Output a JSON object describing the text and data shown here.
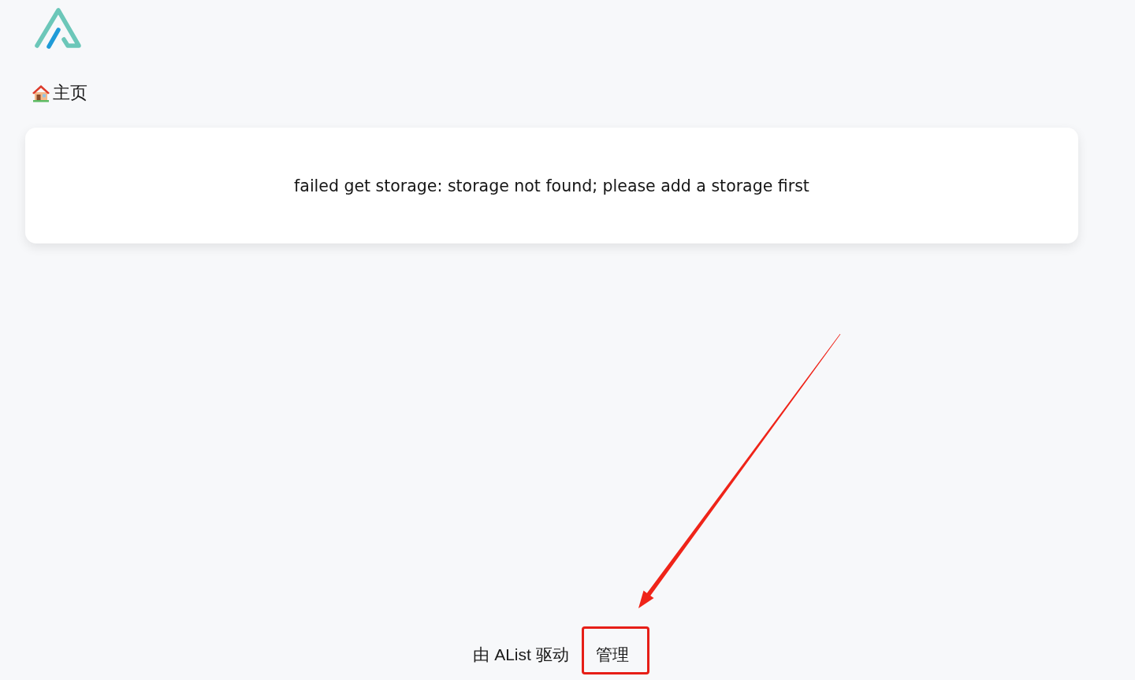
{
  "breadcrumb": [
    {
      "label": "主页",
      "kind": "home"
    }
  ],
  "message": "failed get storage: storage not found; please add a storage first",
  "footer": {
    "links": [
      {
        "label": "由 AList 驱动",
        "highlighted": false
      },
      {
        "label": "管理",
        "highlighted": true
      }
    ]
  }
}
